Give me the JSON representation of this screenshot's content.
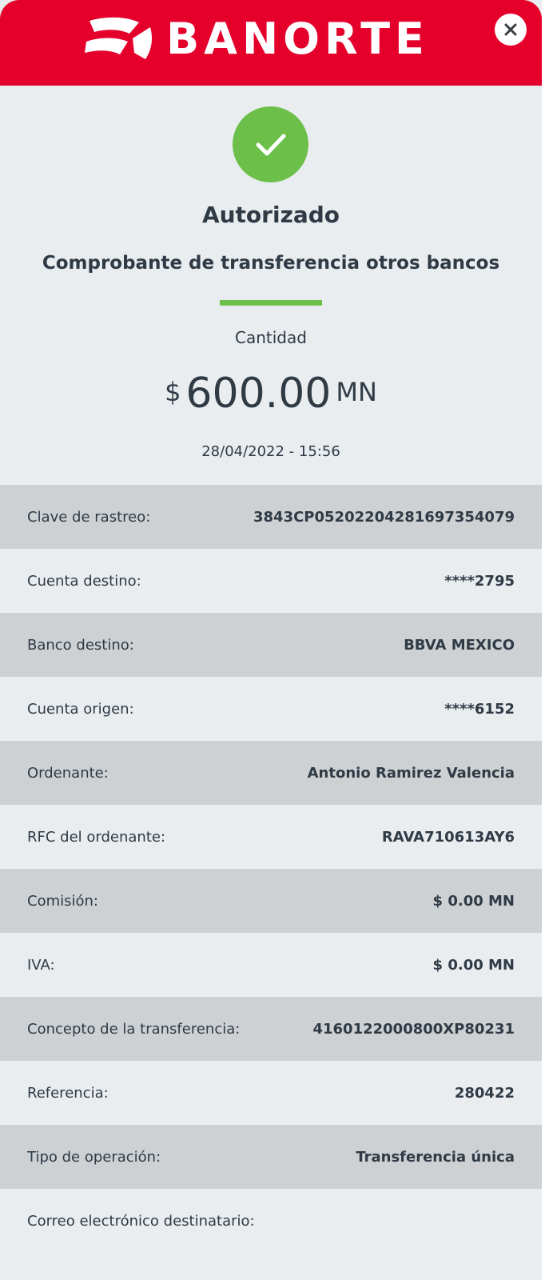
{
  "header": {
    "brand": "BANORTE",
    "logo_icon": "banorte-logo-icon",
    "close_icon": "close-icon",
    "background": "#e4002b"
  },
  "status": {
    "icon": "check-icon",
    "title": "Autorizado",
    "subtitle": "Comprobante de transferencia otros bancos",
    "accent": "#6cc04a"
  },
  "amount": {
    "label": "Cantidad",
    "currency_symbol": "$",
    "value": "600.00",
    "unit": "MN",
    "datetime": "28/04/2022 - 15:56"
  },
  "details": [
    {
      "label": "Clave de rastreo:",
      "value": "3843CP05202204281697354079"
    },
    {
      "label": "Cuenta destino:",
      "value": "****2795"
    },
    {
      "label": "Banco destino:",
      "value": "BBVA MEXICO"
    },
    {
      "label": "Cuenta origen:",
      "value": "****6152"
    },
    {
      "label": "Ordenante:",
      "value": "Antonio Ramirez Valencia"
    },
    {
      "label": "RFC del ordenante:",
      "value": "RAVA710613AY6"
    },
    {
      "label": "Comisión:",
      "value": "$ 0.00 MN"
    },
    {
      "label": "IVA:",
      "value": "$ 0.00 MN"
    },
    {
      "label": "Concepto de la transferencia:",
      "value": "4160122000800XP80231"
    },
    {
      "label": "Referencia:",
      "value": "280422"
    },
    {
      "label": "Tipo de operación:",
      "value": "Transferencia única"
    },
    {
      "label": "Correo electrónico destinatario:",
      "value": ""
    }
  ]
}
